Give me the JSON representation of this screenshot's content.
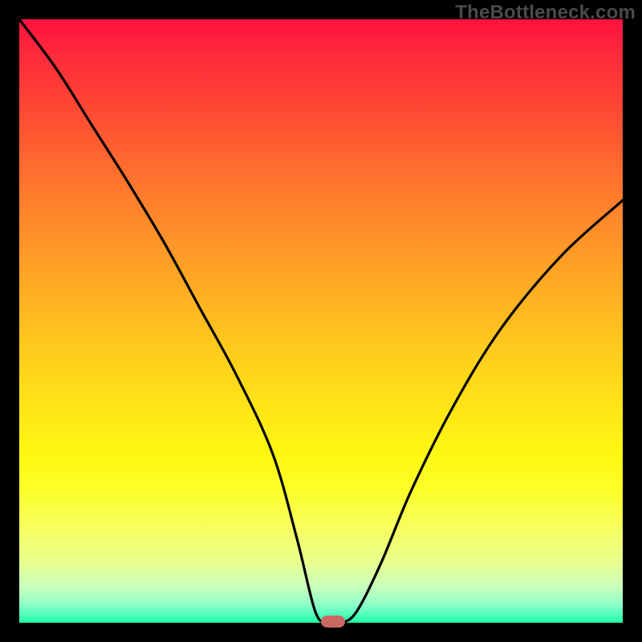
{
  "watermark": "TheBottleneck.com",
  "colors": {
    "frame_bg": "#000000",
    "marker": "#cb6862",
    "curve": "#000000"
  },
  "chart_data": {
    "type": "line",
    "title": "",
    "xlabel": "",
    "ylabel": "",
    "xlim": [
      0,
      100
    ],
    "ylim": [
      0,
      100
    ],
    "grid": false,
    "legend": false,
    "annotations": [
      {
        "text": "TheBottleneck.com",
        "position": "top-right"
      }
    ],
    "x": [
      0,
      6,
      12,
      18,
      24,
      30,
      36,
      42,
      46,
      49,
      51,
      53.5,
      56,
      60,
      65,
      72,
      80,
      90,
      100
    ],
    "values": [
      100,
      92,
      82.5,
      73,
      63,
      52,
      41,
      28,
      14,
      2,
      0,
      0,
      2,
      10,
      22,
      36,
      49,
      61,
      70
    ],
    "marker": {
      "x": 52,
      "y": 0,
      "shape": "pill",
      "color": "#cb6862"
    },
    "description": "V-shaped bottleneck curve on a rainbow gradient background; minimum (0%) occurs near x≈52"
  }
}
